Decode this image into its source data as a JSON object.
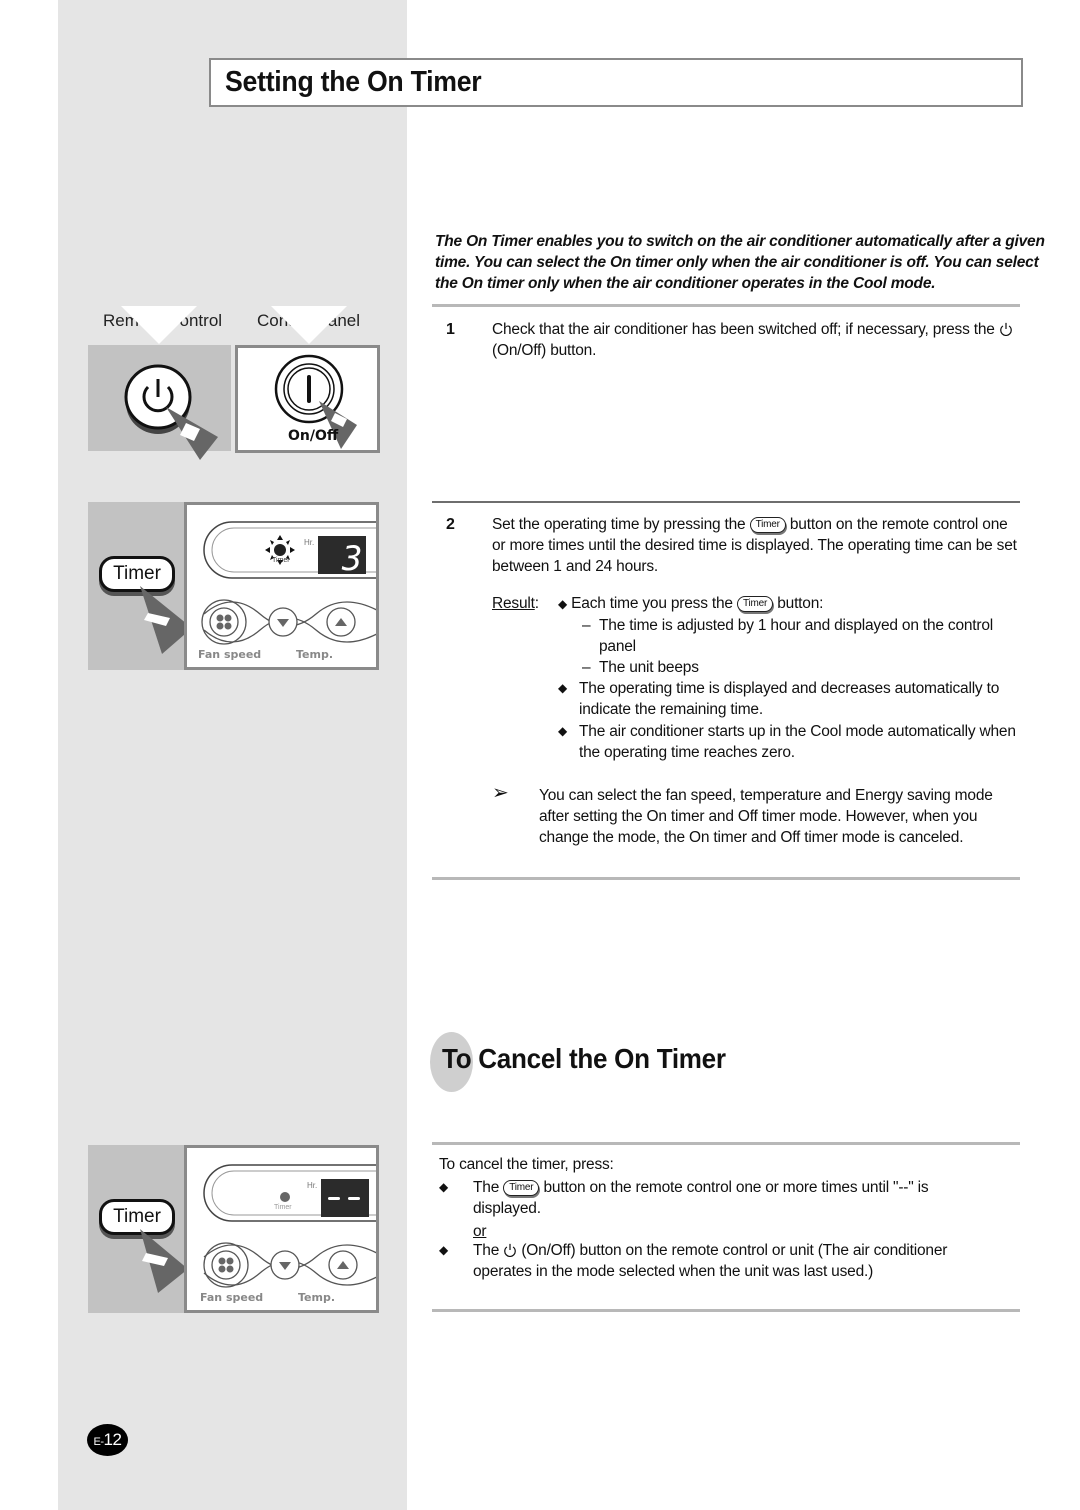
{
  "page": {
    "title": "Setting the On Timer",
    "intro": "The On Timer enables you to switch on the air conditioner automatically after a given time. You can select the On timer only when the air conditioner is off. You can select the On timer only when the air conditioner operates in the Cool mode.",
    "page_number": {
      "prefix": "E-",
      "number": "12"
    }
  },
  "figures": {
    "remote_label": "Remote Control",
    "panel_label": "Control Panel",
    "onoff_label": "On/Off",
    "timer_button": "Timer",
    "fan_speed_label": "Fan speed",
    "temp_label": "Temp.",
    "hr_label": "Hr.",
    "timer_indicator": "Timer",
    "display_value_step2": "3",
    "display_value_cancel": "--"
  },
  "steps": [
    {
      "number": "1",
      "text_before": "Check that the air conditioner has been switched off; if necessary, press the",
      "icon": "power-icon",
      "text_after": "(On/Off) button."
    },
    {
      "number": "2",
      "text_before": "Set the operating time by pressing the",
      "button": "Timer",
      "text_after": "button on the remote control one or more times until the desired time is displayed. The operating time can be set between 1 and 24 hours.",
      "result_label": "Result",
      "result_items": [
        {
          "before": "Each time you press the",
          "button": "Timer",
          "after": "button:"
        },
        {
          "text": "The operating time is displayed and decreases automatically to indicate the remaining time."
        },
        {
          "text": "The air conditioner starts up in the Cool mode automatically when the operating time reaches zero."
        }
      ],
      "sub_items": [
        "The time is adjusted by 1 hour and displayed on the control panel",
        "The unit beeps"
      ],
      "note": "You can select the fan speed, temperature and Energy saving mode after setting the On timer and Off timer mode. However, when you change the mode, the On timer and Off timer mode is canceled."
    }
  ],
  "cancel": {
    "heading_prefix": "To",
    "heading_rest": " Cancel the On Timer",
    "lead": "To cancel the timer, press:",
    "item1_before": "The",
    "item1_button": "Timer",
    "item1_after": "button on the remote control one or more times until \"--\" is displayed.",
    "or": "or",
    "item2_before": "The",
    "item2_after": "(On/Off) button on  the remote control or unit (The air conditioner operates in the mode selected when the unit was last used.)"
  }
}
